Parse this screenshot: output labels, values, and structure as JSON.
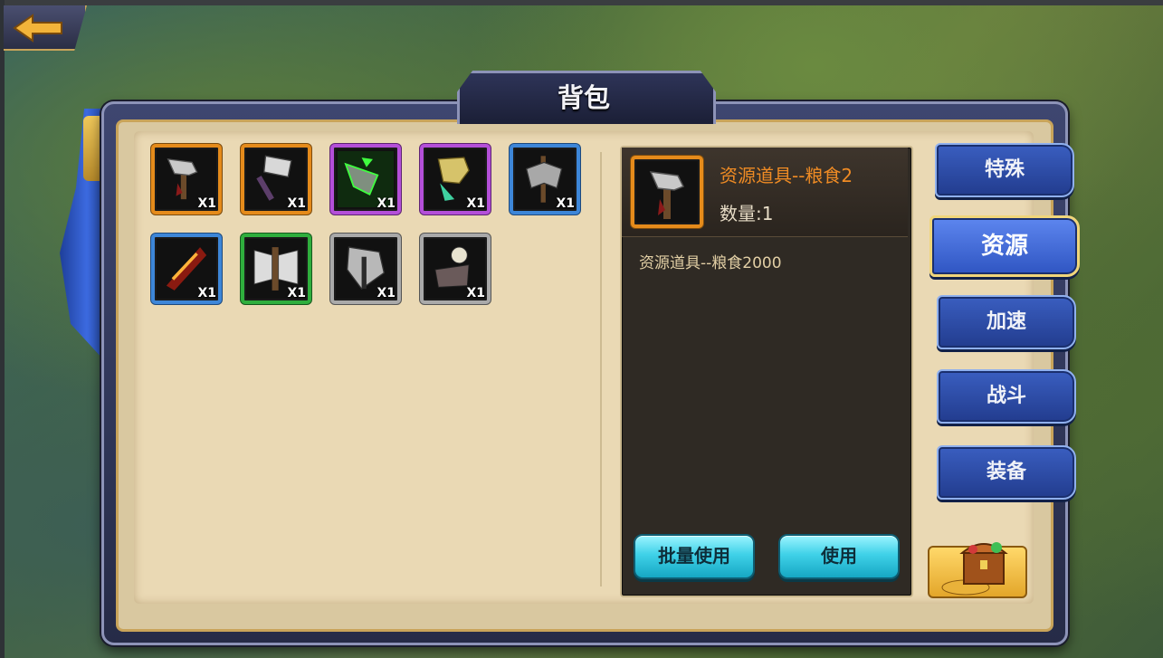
{
  "window": {
    "title": "背包"
  },
  "nav": {
    "back_icon": "back-arrow-icon"
  },
  "inventory": {
    "items": [
      {
        "icon": "axe-icon",
        "rarity": "orange",
        "qty": "X1"
      },
      {
        "icon": "hammer-icon",
        "rarity": "orange",
        "qty": "X1"
      },
      {
        "icon": "cursed-axe-icon",
        "rarity": "purple",
        "qty": "X1"
      },
      {
        "icon": "golden-axe-icon",
        "rarity": "purple",
        "qty": "X1"
      },
      {
        "icon": "battle-axe-icon",
        "rarity": "blue",
        "qty": "X1"
      },
      {
        "icon": "flame-blade-icon",
        "rarity": "blue",
        "qty": "X1"
      },
      {
        "icon": "steel-axe-icon",
        "rarity": "green",
        "qty": "X1"
      },
      {
        "icon": "spiked-axe-icon",
        "rarity": "gray",
        "qty": "X1"
      },
      {
        "icon": "skull-axe-icon",
        "rarity": "gray",
        "qty": "X1"
      }
    ]
  },
  "detail": {
    "icon": "axe-icon",
    "rarity": "orange",
    "name": "资源道具--粮食2",
    "quantity": "数量:1",
    "description": "资源道具--粮食2000",
    "batch_use_label": "批量使用",
    "use_label": "使用"
  },
  "tabs": [
    {
      "label": "特殊",
      "active": false
    },
    {
      "label": "资源",
      "active": true
    },
    {
      "label": "加速",
      "active": false
    },
    {
      "label": "战斗",
      "active": false
    },
    {
      "label": "装备",
      "active": false
    }
  ],
  "chest": {
    "icon": "treasure-chest-icon"
  },
  "colors": {
    "orange": "#e58b1b",
    "purple": "#b44fd9",
    "blue": "#3d86d8",
    "green": "#2fae3d",
    "gray": "#a9a9a9",
    "item_name": "#ef8b24"
  }
}
